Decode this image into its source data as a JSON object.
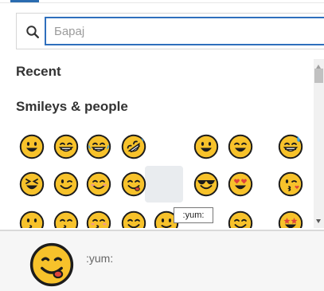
{
  "search": {
    "placeholder": "Барај",
    "value": ""
  },
  "sections": {
    "recent_label": "Recent",
    "smileys_label": "Smileys & people"
  },
  "emoji_names": [
    "grinning-face",
    "grinning-face-with-smiling-eyes",
    "face-with-tears-of-joy",
    "rolling-on-the-floor-laughing",
    "smiling-face-with-open-mouth",
    "smiling-face-with-open-mouth-and-smiling-eyes",
    "grinning-face-with-sweat",
    "laughing-face",
    "winking-face",
    "smiling-face-with-smiling-eyes",
    "face-savouring-food",
    "smiling-face-with-sunglasses",
    "smiling-face-with-heart-eyes",
    "face-throwing-a-kiss",
    "kissing-face",
    "kissing-face-with-smiling-eyes",
    "kissing-face-with-closed-eyes",
    "smiling-face",
    "slightly-smiling-face",
    "hugging-face",
    "star-struck"
  ],
  "tooltip": {
    "text": ":yum:"
  },
  "preview": {
    "label": ":yum:"
  },
  "colors": {
    "accent": "#2f6fbd",
    "emoji_fill": "#f7c22b",
    "emoji_stroke": "#1c1c1c",
    "tongue": "#e0443a",
    "tears": "#3aa0e8",
    "preview_bg": "#f6f6f6"
  }
}
